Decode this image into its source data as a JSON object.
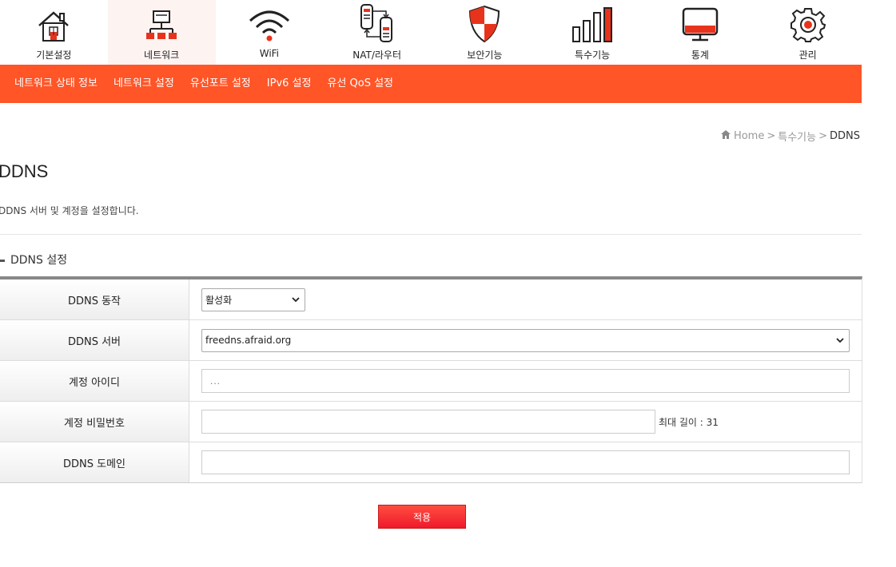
{
  "top_nav": [
    {
      "label": "기본설정",
      "icon": "house-icon"
    },
    {
      "label": "네트워크",
      "icon": "network-icon",
      "active": true
    },
    {
      "label": "WiFi",
      "icon": "wifi-icon"
    },
    {
      "label": "NAT/라우터",
      "icon": "router-icon"
    },
    {
      "label": "보안기능",
      "icon": "shield-icon"
    },
    {
      "label": "특수기능",
      "icon": "bars-icon"
    },
    {
      "label": "통계",
      "icon": "monitor-icon"
    },
    {
      "label": "관리",
      "icon": "gear-icon"
    }
  ],
  "sub_nav": [
    "네트워크 상태 정보",
    "네트워크 설정",
    "유선포트 설정",
    "IPv6 설정",
    "유선 QoS 설정"
  ],
  "breadcrumb": {
    "home": "Home",
    "parent": "특수기능",
    "current": "DDNS",
    "separator": ">"
  },
  "page": {
    "title": "DDNS",
    "description": "DDNS 서버 및 계정을 설정합니다.",
    "section_title": "DDNS 설정"
  },
  "form": {
    "ddns_action": {
      "label": "DDNS 동작",
      "value": "활성화"
    },
    "ddns_server": {
      "label": "DDNS 서버",
      "value": "freedns.afraid.org"
    },
    "account_id": {
      "label": "계정 아이디",
      "value": "..."
    },
    "account_password": {
      "label": "계정 비밀번호",
      "value": "",
      "hint": "최대 길이 : 31"
    },
    "ddns_domain": {
      "label": "DDNS 도메인",
      "value": ""
    }
  },
  "apply_label": "적용",
  "colors": {
    "accent": "#ff5527",
    "button": "#ef1a2c",
    "icon_red": "#e8331c"
  }
}
